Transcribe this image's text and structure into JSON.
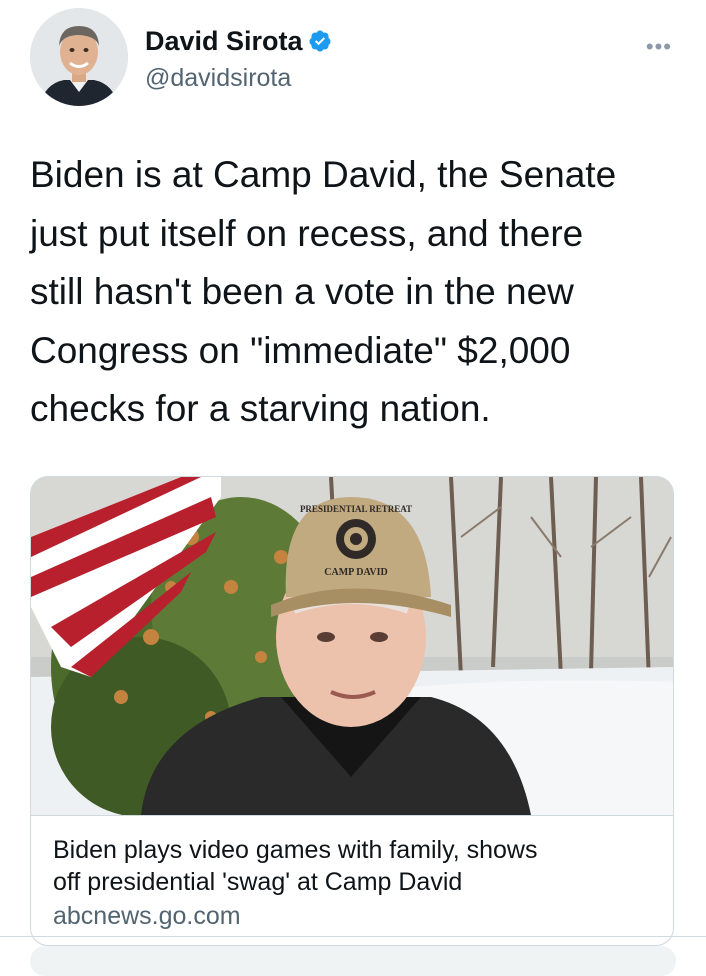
{
  "tweet": {
    "author_name": "David Sirota",
    "author_handle": "@davidsirota",
    "verified": true,
    "more_icon": "more-horizontal-icon",
    "text_lines": [
      "Biden is at Camp David, the Senate",
      "just put itself on recess, and there",
      "still hasn't been a vote in the new",
      "Congress on \"immediate\" $2,000",
      "checks for a starving nation."
    ]
  },
  "link_card": {
    "title_lines": [
      "Biden plays video games with family, shows",
      "off presidential 'swag' at Camp David"
    ],
    "domain": "abcnews.go.com",
    "image_cap_text_1": "PRESIDENTIAL RETREAT",
    "image_cap_text_2": "CAMP DAVID"
  },
  "colors": {
    "verified_blue": "#1d9bf0",
    "text_primary": "#0f1419",
    "text_secondary": "#536471",
    "border": "#cfd9de"
  }
}
